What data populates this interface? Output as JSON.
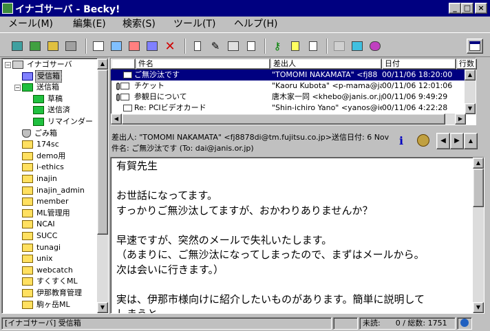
{
  "window": {
    "title": "イナゴサーバ - Becky!"
  },
  "menu": [
    "メール(M)",
    "編集(E)",
    "検索(S)",
    "ツール(T)",
    "ヘルプ(H)"
  ],
  "folders": [
    {
      "label": "イナゴサーバ",
      "level": 0,
      "type": "server",
      "expander": "−"
    },
    {
      "label": "受信箱",
      "level": 1,
      "type": "inbox",
      "selected": true
    },
    {
      "label": "送信箱",
      "level": 1,
      "type": "green",
      "expander": "−"
    },
    {
      "label": "草稿",
      "level": 2,
      "type": "green"
    },
    {
      "label": "送信済",
      "level": 2,
      "type": "green"
    },
    {
      "label": "リマインダー",
      "level": 2,
      "type": "green"
    },
    {
      "label": "ごみ箱",
      "level": 1,
      "type": "trash"
    },
    {
      "label": "174sc",
      "level": 1,
      "type": "folder"
    },
    {
      "label": "demo用",
      "level": 1,
      "type": "folder"
    },
    {
      "label": "i-ethics",
      "level": 1,
      "type": "folder"
    },
    {
      "label": "inajin",
      "level": 1,
      "type": "folder"
    },
    {
      "label": "inajin_admin",
      "level": 1,
      "type": "folder"
    },
    {
      "label": "member",
      "level": 1,
      "type": "folder"
    },
    {
      "label": "ML管理用",
      "level": 1,
      "type": "folder"
    },
    {
      "label": "NCAI",
      "level": 1,
      "type": "folder"
    },
    {
      "label": "SUCC",
      "level": 1,
      "type": "folder"
    },
    {
      "label": "tunagi",
      "level": 1,
      "type": "folder"
    },
    {
      "label": "unix",
      "level": 1,
      "type": "folder"
    },
    {
      "label": "webcatch",
      "level": 1,
      "type": "folder"
    },
    {
      "label": "すくすくML",
      "level": 1,
      "type": "folder"
    },
    {
      "label": "伊那教育管理",
      "level": 1,
      "type": "folder"
    },
    {
      "label": "駒ヶ岳ML",
      "level": 1,
      "type": "folder"
    }
  ],
  "list": {
    "columns": [
      "件名",
      "差出人",
      "日付",
      "行数"
    ],
    "rows": [
      {
        "subject": "ご無沙汰です",
        "from": "\"TOMOMI NAKAMATA\" <fj88",
        "date": "00/11/06 18:20:00",
        "selected": true,
        "clip": false
      },
      {
        "subject": "チケット",
        "from": "\"Kaoru Kubota\" <p-mama@jan",
        "date": "00/11/06 12:01:06",
        "clip": true
      },
      {
        "subject": "参観日について",
        "from": "唐木家一同 <khebo@janis.or.jp>",
        "date": "00/11/06 9:49:29",
        "clip": true
      },
      {
        "subject": "Re: PCIビデオカード",
        "from": "\"Shin-ichiro Yano\" <yanos@ie",
        "date": "00/11/06 4:22:28",
        "clip": false
      }
    ]
  },
  "header": {
    "from": "差出人: \"TOMOMI NAKAMATA\" <fj8878di@tm.fujitsu.co.jp>",
    "sent": "送信日付: 6 Nov",
    "subject": "件名: ご無沙汰です (To: dai@janis.or.jp)"
  },
  "body": "有賀先生\n\nお世話になってます。\nすっかりご無沙汰してますが、おかわりありませんか？\n\n早速ですが、突然のメールで失礼いたします。\n（あまりに、ご無沙汰になってしまったので、まずはメールから。\n次は会いに行きます。）\n\n実は、伊那市様向けに紹介したいものがあります。簡単に説明して\nしまうと、\n「教育イントラネットを構築し、学校で安心して利用できるＩＴ環\n境を作りましょう」というものです。",
  "status": {
    "folder": "[イナゴサーバ] 受信箱",
    "counts": "未読:　　0 / 総数: 1751"
  }
}
